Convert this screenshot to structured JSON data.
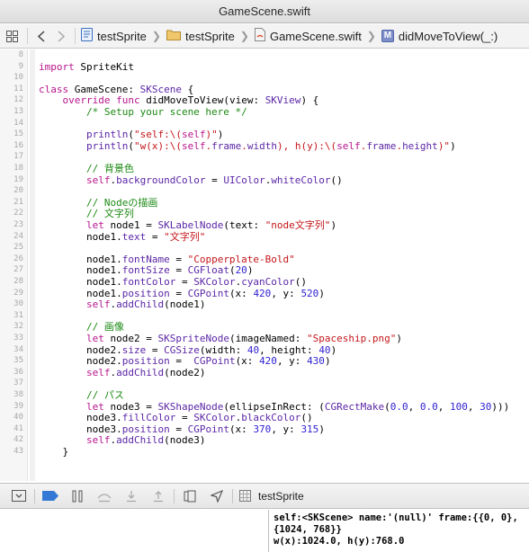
{
  "window": {
    "title": "GameScene.swift"
  },
  "jumpbar": {
    "crumbs": [
      {
        "label": "testSprite",
        "icon": "project-icon"
      },
      {
        "label": "testSprite",
        "icon": "folder-icon"
      },
      {
        "label": "GameScene.swift",
        "icon": "swift-file-icon"
      },
      {
        "label": "didMoveToView(_:)",
        "icon": "method-icon",
        "badge": "M"
      }
    ],
    "icons": [
      "grid-icon",
      "back-arrow-icon",
      "forward-arrow-icon"
    ]
  },
  "editor": {
    "lines": [
      {
        "n": "8",
        "spans": []
      },
      {
        "n": "9",
        "spans": [
          {
            "c": "kw",
            "t": "import"
          },
          {
            "c": "",
            "t": " SpriteKit"
          }
        ]
      },
      {
        "n": "10",
        "spans": []
      },
      {
        "n": "11",
        "spans": [
          {
            "c": "kw",
            "t": "class"
          },
          {
            "c": "",
            "t": " GameScene: "
          },
          {
            "c": "ty",
            "t": "SKScene"
          },
          {
            "c": "",
            "t": " {"
          }
        ]
      },
      {
        "n": "12",
        "spans": [
          {
            "c": "",
            "t": "    "
          },
          {
            "c": "kw",
            "t": "override"
          },
          {
            "c": "",
            "t": " "
          },
          {
            "c": "kw",
            "t": "func"
          },
          {
            "c": "",
            "t": " didMoveToView(view: "
          },
          {
            "c": "ty",
            "t": "SKView"
          },
          {
            "c": "",
            "t": ") {"
          }
        ]
      },
      {
        "n": "13",
        "spans": [
          {
            "c": "cm",
            "t": "        /* Setup your scene here */"
          }
        ]
      },
      {
        "n": "14",
        "spans": []
      },
      {
        "n": "15",
        "spans": [
          {
            "c": "",
            "t": "        "
          },
          {
            "c": "ty",
            "t": "println"
          },
          {
            "c": "",
            "t": "("
          },
          {
            "c": "st",
            "t": "\"self:\\("
          },
          {
            "c": "kw",
            "t": "self"
          },
          {
            "c": "st",
            "t": ")\""
          },
          {
            "c": "",
            "t": ")"
          }
        ]
      },
      {
        "n": "16",
        "spans": [
          {
            "c": "",
            "t": "        "
          },
          {
            "c": "ty",
            "t": "println"
          },
          {
            "c": "",
            "t": "("
          },
          {
            "c": "st",
            "t": "\"w(x):\\("
          },
          {
            "c": "kw",
            "t": "self"
          },
          {
            "c": "st",
            "t": "."
          },
          {
            "c": "ty",
            "t": "frame"
          },
          {
            "c": "st",
            "t": "."
          },
          {
            "c": "ty",
            "t": "width"
          },
          {
            "c": "st",
            "t": "), h(y):\\("
          },
          {
            "c": "kw",
            "t": "self"
          },
          {
            "c": "st",
            "t": "."
          },
          {
            "c": "ty",
            "t": "frame"
          },
          {
            "c": "st",
            "t": "."
          },
          {
            "c": "ty",
            "t": "height"
          },
          {
            "c": "st",
            "t": ")\""
          },
          {
            "c": "",
            "t": ")"
          }
        ]
      },
      {
        "n": "17",
        "spans": []
      },
      {
        "n": "18",
        "spans": [
          {
            "c": "cm",
            "t": "        // 背景色"
          }
        ]
      },
      {
        "n": "19",
        "spans": [
          {
            "c": "",
            "t": "        "
          },
          {
            "c": "kw",
            "t": "self"
          },
          {
            "c": "",
            "t": "."
          },
          {
            "c": "ty",
            "t": "backgroundColor"
          },
          {
            "c": "",
            "t": " = "
          },
          {
            "c": "ty",
            "t": "UIColor"
          },
          {
            "c": "",
            "t": "."
          },
          {
            "c": "ty",
            "t": "whiteColor"
          },
          {
            "c": "",
            "t": "()"
          }
        ]
      },
      {
        "n": "20",
        "spans": []
      },
      {
        "n": "21",
        "spans": [
          {
            "c": "cm",
            "t": "        // Nodeの描画"
          }
        ]
      },
      {
        "n": "22",
        "spans": [
          {
            "c": "cm",
            "t": "        // 文字列"
          }
        ]
      },
      {
        "n": "23",
        "spans": [
          {
            "c": "",
            "t": "        "
          },
          {
            "c": "kw",
            "t": "let"
          },
          {
            "c": "",
            "t": " node1 = "
          },
          {
            "c": "ty",
            "t": "SKLabelNode"
          },
          {
            "c": "",
            "t": "(text: "
          },
          {
            "c": "st",
            "t": "\"node文字列\""
          },
          {
            "c": "",
            "t": ")"
          }
        ]
      },
      {
        "n": "24",
        "spans": [
          {
            "c": "",
            "t": "        node1."
          },
          {
            "c": "ty",
            "t": "text"
          },
          {
            "c": "",
            "t": " = "
          },
          {
            "c": "st",
            "t": "\"文字列\""
          }
        ]
      },
      {
        "n": "25",
        "spans": []
      },
      {
        "n": "26",
        "spans": [
          {
            "c": "",
            "t": "        node1."
          },
          {
            "c": "ty",
            "t": "fontName"
          },
          {
            "c": "",
            "t": " = "
          },
          {
            "c": "st",
            "t": "\"Copperplate-Bold\""
          }
        ]
      },
      {
        "n": "27",
        "spans": [
          {
            "c": "",
            "t": "        node1."
          },
          {
            "c": "ty",
            "t": "fontSize"
          },
          {
            "c": "",
            "t": " = "
          },
          {
            "c": "ty",
            "t": "CGFloat"
          },
          {
            "c": "",
            "t": "("
          },
          {
            "c": "nm",
            "t": "20"
          },
          {
            "c": "",
            "t": ")"
          }
        ]
      },
      {
        "n": "28",
        "spans": [
          {
            "c": "",
            "t": "        node1."
          },
          {
            "c": "ty",
            "t": "fontColor"
          },
          {
            "c": "",
            "t": " = "
          },
          {
            "c": "ty",
            "t": "SKColor"
          },
          {
            "c": "",
            "t": "."
          },
          {
            "c": "ty",
            "t": "cyanColor"
          },
          {
            "c": "",
            "t": "()"
          }
        ]
      },
      {
        "n": "29",
        "spans": [
          {
            "c": "",
            "t": "        node1."
          },
          {
            "c": "ty",
            "t": "position"
          },
          {
            "c": "",
            "t": " = "
          },
          {
            "c": "ty",
            "t": "CGPoint"
          },
          {
            "c": "",
            "t": "(x: "
          },
          {
            "c": "nm",
            "t": "420"
          },
          {
            "c": "",
            "t": ", y: "
          },
          {
            "c": "nm",
            "t": "520"
          },
          {
            "c": "",
            "t": ")"
          }
        ]
      },
      {
        "n": "30",
        "spans": [
          {
            "c": "",
            "t": "        "
          },
          {
            "c": "kw",
            "t": "self"
          },
          {
            "c": "",
            "t": "."
          },
          {
            "c": "ty",
            "t": "addChild"
          },
          {
            "c": "",
            "t": "(node1)"
          }
        ]
      },
      {
        "n": "31",
        "spans": []
      },
      {
        "n": "32",
        "spans": [
          {
            "c": "cm",
            "t": "        // 画像"
          }
        ]
      },
      {
        "n": "33",
        "spans": [
          {
            "c": "",
            "t": "        "
          },
          {
            "c": "kw",
            "t": "let"
          },
          {
            "c": "",
            "t": " node2 = "
          },
          {
            "c": "ty",
            "t": "SKSpriteNode"
          },
          {
            "c": "",
            "t": "(imageNamed: "
          },
          {
            "c": "st",
            "t": "\"Spaceship.png\""
          },
          {
            "c": "",
            "t": ")"
          }
        ]
      },
      {
        "n": "34",
        "spans": [
          {
            "c": "",
            "t": "        node2."
          },
          {
            "c": "ty",
            "t": "size"
          },
          {
            "c": "",
            "t": " = "
          },
          {
            "c": "ty",
            "t": "CGSize"
          },
          {
            "c": "",
            "t": "(width: "
          },
          {
            "c": "nm",
            "t": "40"
          },
          {
            "c": "",
            "t": ", height: "
          },
          {
            "c": "nm",
            "t": "40"
          },
          {
            "c": "",
            "t": ")"
          }
        ]
      },
      {
        "n": "35",
        "spans": [
          {
            "c": "",
            "t": "        node2."
          },
          {
            "c": "ty",
            "t": "position"
          },
          {
            "c": "",
            "t": " =  "
          },
          {
            "c": "ty",
            "t": "CGPoint"
          },
          {
            "c": "",
            "t": "(x: "
          },
          {
            "c": "nm",
            "t": "420"
          },
          {
            "c": "",
            "t": ", y: "
          },
          {
            "c": "nm",
            "t": "430"
          },
          {
            "c": "",
            "t": ")"
          }
        ]
      },
      {
        "n": "36",
        "spans": [
          {
            "c": "",
            "t": "        "
          },
          {
            "c": "kw",
            "t": "self"
          },
          {
            "c": "",
            "t": "."
          },
          {
            "c": "ty",
            "t": "addChild"
          },
          {
            "c": "",
            "t": "(node2)"
          }
        ]
      },
      {
        "n": "37",
        "spans": []
      },
      {
        "n": "38",
        "spans": [
          {
            "c": "cm",
            "t": "        // パス"
          }
        ]
      },
      {
        "n": "39",
        "spans": [
          {
            "c": "",
            "t": "        "
          },
          {
            "c": "kw",
            "t": "let"
          },
          {
            "c": "",
            "t": " node3 = "
          },
          {
            "c": "ty",
            "t": "SKShapeNode"
          },
          {
            "c": "",
            "t": "(ellipseInRect: ("
          },
          {
            "c": "ty",
            "t": "CGRectMake"
          },
          {
            "c": "",
            "t": "("
          },
          {
            "c": "nm",
            "t": "0.0"
          },
          {
            "c": "",
            "t": ", "
          },
          {
            "c": "nm",
            "t": "0.0"
          },
          {
            "c": "",
            "t": ", "
          },
          {
            "c": "nm",
            "t": "100"
          },
          {
            "c": "",
            "t": ", "
          },
          {
            "c": "nm",
            "t": "30"
          },
          {
            "c": "",
            "t": ")))"
          }
        ]
      },
      {
        "n": "40",
        "spans": [
          {
            "c": "",
            "t": "        node3."
          },
          {
            "c": "ty",
            "t": "fillColor"
          },
          {
            "c": "",
            "t": " = "
          },
          {
            "c": "ty",
            "t": "SKColor"
          },
          {
            "c": "",
            "t": "."
          },
          {
            "c": "ty",
            "t": "blackColor"
          },
          {
            "c": "",
            "t": "()"
          }
        ]
      },
      {
        "n": "41",
        "spans": [
          {
            "c": "",
            "t": "        node3."
          },
          {
            "c": "ty",
            "t": "position"
          },
          {
            "c": "",
            "t": " = "
          },
          {
            "c": "ty",
            "t": "CGPoint"
          },
          {
            "c": "",
            "t": "(x: "
          },
          {
            "c": "nm",
            "t": "370"
          },
          {
            "c": "",
            "t": ", y: "
          },
          {
            "c": "nm",
            "t": "315"
          },
          {
            "c": "",
            "t": ")"
          }
        ]
      },
      {
        "n": "42",
        "spans": [
          {
            "c": "",
            "t": "        "
          },
          {
            "c": "kw",
            "t": "self"
          },
          {
            "c": "",
            "t": "."
          },
          {
            "c": "ty",
            "t": "addChild"
          },
          {
            "c": "",
            "t": "(node3)"
          }
        ]
      },
      {
        "n": "43",
        "spans": [
          {
            "c": "",
            "t": "    }"
          }
        ]
      }
    ]
  },
  "debugbar": {
    "target": "testSprite",
    "icons": [
      "hide-debug-area-icon",
      "breakpoints-toggle-icon",
      "pause-icon",
      "step-over-icon",
      "step-into-icon",
      "step-out-icon",
      "view-debugger-icon",
      "simulate-location-icon",
      "target-icon"
    ]
  },
  "console": {
    "output": "self:<SKScene> name:'(null)' frame:{{0, 0}, {1024, 768}}\nw(x):1024.0, h(y):768.0"
  },
  "colors": {
    "keyword": "#b6168d",
    "type": "#5b26a6",
    "string": "#c4171b",
    "comment": "#1d8a14",
    "number": "#2d1fd1",
    "selection_blue": "#3478d6"
  }
}
